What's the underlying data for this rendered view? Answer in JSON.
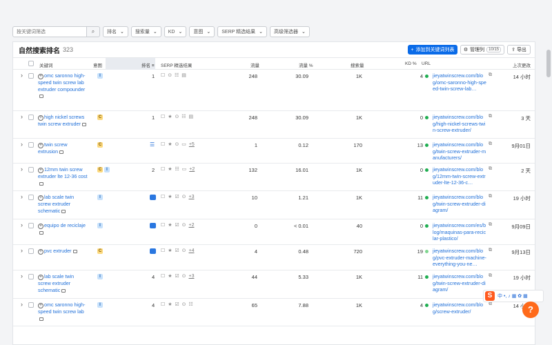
{
  "filters": {
    "search_placeholder": "按关键词筛选",
    "search_icon": "search-icon",
    "dropdowns": [
      "排名",
      "搜索量",
      "KD",
      "意图",
      "SERP 精选结果",
      "高级筛选器"
    ]
  },
  "panel": {
    "title": "自然搜索排名",
    "count": "323",
    "add_button": "添加到关键词列表",
    "columns_button": "管理列",
    "columns_badge": "10/15",
    "export_button": "导出"
  },
  "headers": {
    "keyword": "关键词",
    "intent": "意图",
    "position": "排名",
    "serp": "SERP 精选结果",
    "traffic": "流量",
    "traffic_pct": "流量 %",
    "volume": "搜索量",
    "kd": "KD %",
    "url": "URL",
    "updated": "上次更改"
  },
  "rows": [
    {
      "kw": "omc saronno high-speed twin screw lab extruder compounder",
      "intents": [
        "I"
      ],
      "pos": "1",
      "own": "",
      "feats": "☐ ⊙ ☷ ▤",
      "more": "",
      "traffic": "248",
      "pct": "30.09",
      "vol": "1K",
      "kd": "4",
      "kd_color": "#1fae51",
      "url": "jieyatwinscrew.com/blog/omc-saronno-high-speed-twin-screw-lab…",
      "upd": "14 小时"
    },
    {
      "kw": "high nickel screws twin screw extruder",
      "intents": [
        "C"
      ],
      "pos": "1",
      "own": "",
      "feats": "☐ ★ ⊙ ☷ ▤",
      "more": "",
      "traffic": "248",
      "pct": "30.09",
      "vol": "1K",
      "kd": "0",
      "kd_color": "#1fae51",
      "url": "jieyatwinscrew.com/blog/high-nickel-screws-twin-screw-extruder/",
      "upd": "3 天"
    },
    {
      "kw": "twin screw extrusion",
      "intents": [
        "C"
      ],
      "pos": "",
      "own": "list",
      "feats": "☐ ★ ⊙ ▭",
      "more": "+5",
      "traffic": "1",
      "pct": "0.12",
      "vol": "170",
      "kd": "13",
      "kd_color": "#1fae51",
      "url": "jieyatwinscrew.com/blog/twin-screw-extruder-manufacturers/",
      "upd": "9月01日"
    },
    {
      "kw": "12mm twin screw extruder lte 12-36 cost",
      "intents": [
        "C",
        "I"
      ],
      "pos": "2",
      "own": "",
      "feats": "☐ ★ ☷ ▭",
      "more": "+2",
      "traffic": "132",
      "pct": "16.01",
      "vol": "1K",
      "kd": "0",
      "kd_color": "#1fae51",
      "url": "jieyatwinscrew.com/blog/12mm-twin-screw-extruder-lte-12-36-c…",
      "upd": "2 天"
    },
    {
      "kw": "lab scale twin screw extruder schematic",
      "intents": [
        "I"
      ],
      "pos": "",
      "own": "img",
      "feats": "☐ ★ ☑ ⊙",
      "more": "+3",
      "traffic": "10",
      "pct": "1.21",
      "vol": "1K",
      "kd": "11",
      "kd_color": "#1fae51",
      "url": "jieyatwinscrew.com/blog/twin-screw-extruder-diagram/",
      "upd": "19 小时"
    },
    {
      "kw": "equipo de reciclaje",
      "intents": [
        "I"
      ],
      "pos": "",
      "own": "img",
      "feats": "☐ ★ ☑ ⊙",
      "more": "+2",
      "traffic": "0",
      "pct": "< 0.01",
      "vol": "40",
      "kd": "0",
      "kd_color": "#1fae51",
      "url": "jieyatwinscrew.com/es/blog/maquinas-para-reciclar-plastico/",
      "upd": "9月09日"
    },
    {
      "kw": "pvc extruder",
      "intents": [
        "C"
      ],
      "pos": "",
      "own": "img",
      "feats": "☐ ★ ☑ ⊙",
      "more": "+4",
      "traffic": "4",
      "pct": "0.48",
      "vol": "720",
      "kd": "19",
      "kd_color": "#7fd68f",
      "url": "jieyatwinscrew.com/blog/pvc-extruder-machine-everything-you-ne…",
      "upd": "9月13日"
    },
    {
      "kw": "lab scale twin screw extruder schematic",
      "intents": [
        "I"
      ],
      "pos": "4",
      "own": "",
      "feats": "☐ ★ ☑ ⊙",
      "more": "+3",
      "traffic": "44",
      "pct": "5.33",
      "vol": "1K",
      "kd": "11",
      "kd_color": "#1fae51",
      "url": "jieyatwinscrew.com/blog/twin-screw-extruder-diagram/",
      "upd": "19 小时"
    },
    {
      "kw": "omc saronno high-speed twin screw lab",
      "intents": [
        "I"
      ],
      "pos": "4",
      "own": "",
      "feats": "☐ ★ ☑ ⊙ ☷",
      "more": "",
      "traffic": "65",
      "pct": "7.88",
      "vol": "1K",
      "kd": "4",
      "kd_color": "#1fae51",
      "url": "jieyatwinscrew.com/blog/screw-extruder/",
      "upd": "14 小时"
    }
  ],
  "ime": {
    "logo": "S",
    "label": "中 •, ♪ ▦ ✿ ▦"
  },
  "help_label": "?"
}
